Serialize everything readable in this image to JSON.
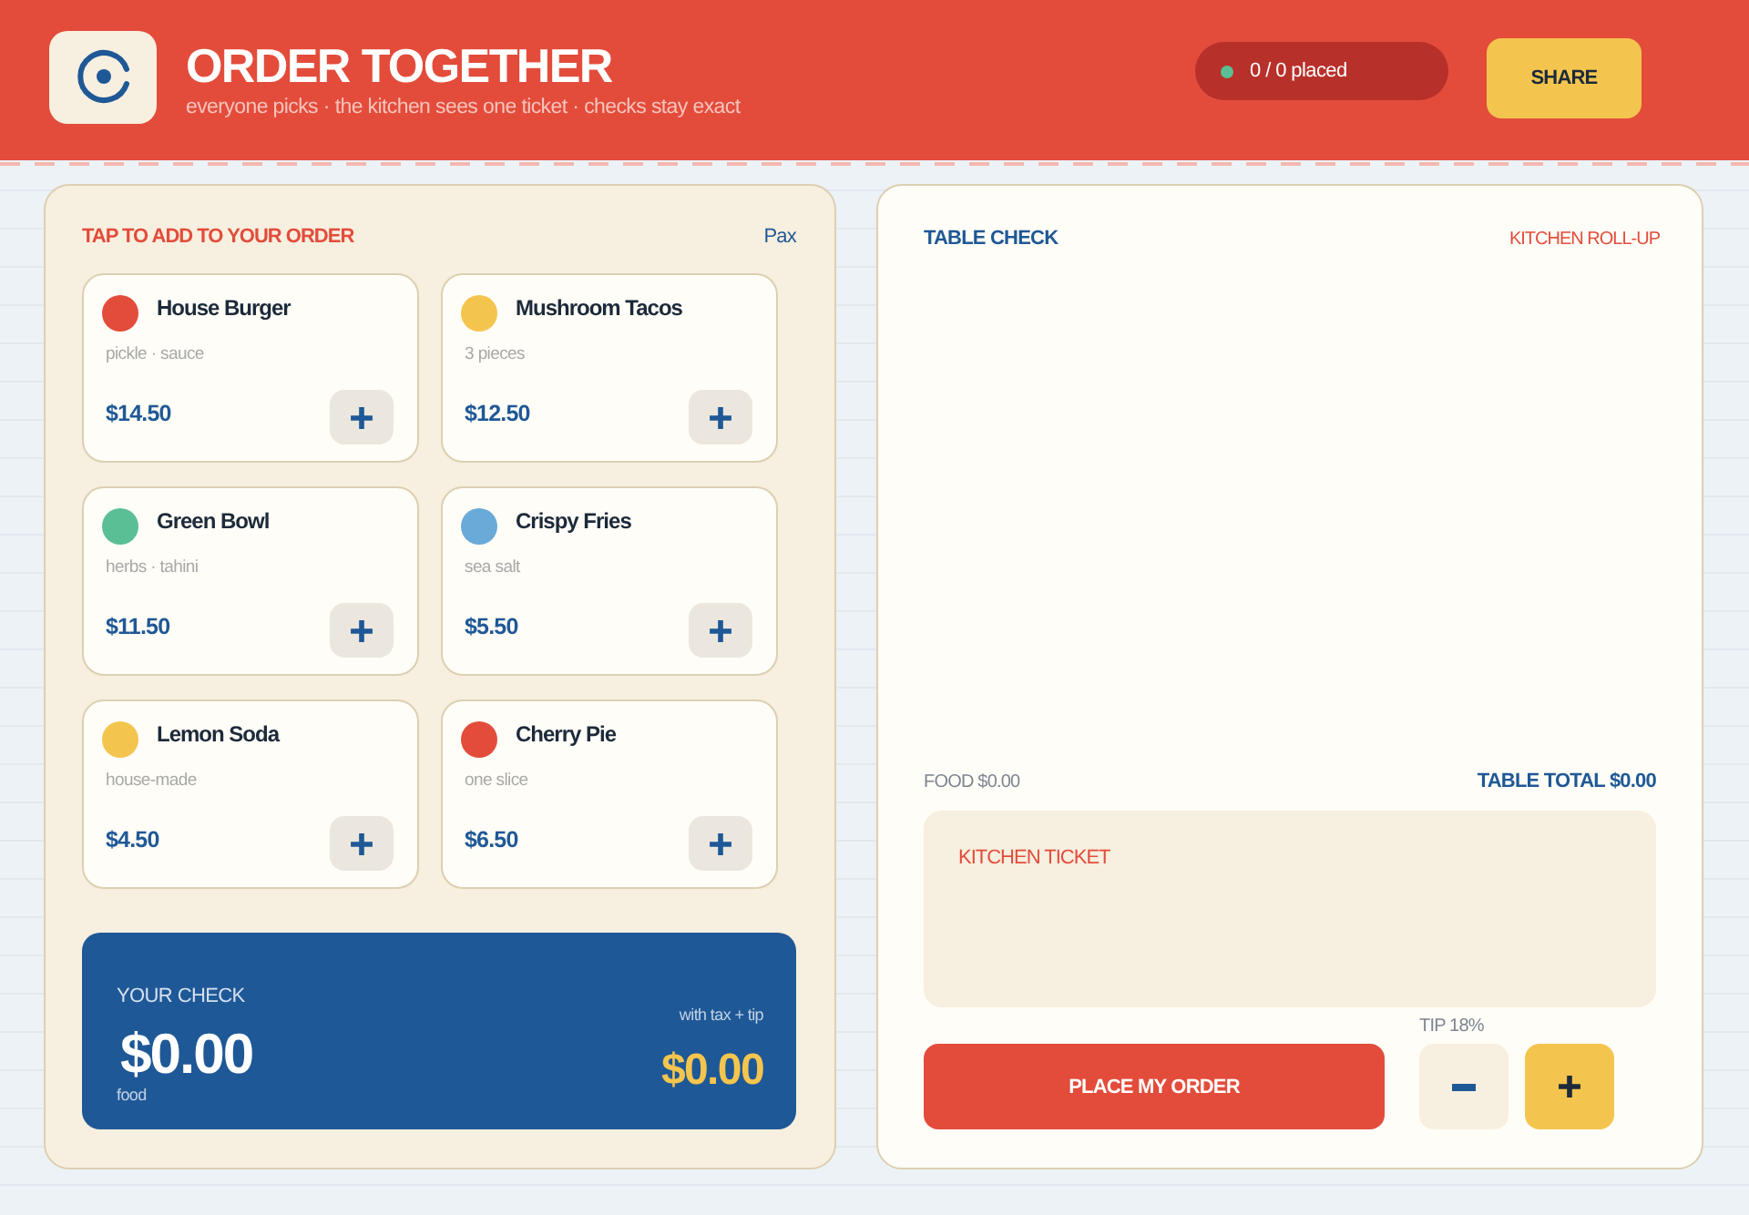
{
  "header": {
    "title": "ORDER TOGETHER",
    "subtitle": "everyone picks · the kitchen sees one ticket · checks stay exact",
    "status": "0 / 0 placed",
    "share_button": "SHARE"
  },
  "menu": {
    "heading": "TAP TO ADD TO YOUR ORDER",
    "diner": "Pax",
    "items": [
      {
        "name": "House Burger",
        "note": "pickle · sauce",
        "price": "$14.50",
        "color": "#e34c3b"
      },
      {
        "name": "Mushroom Tacos",
        "note": "3 pieces",
        "price": "$12.50",
        "color": "#f4c54e"
      },
      {
        "name": "Green Bowl",
        "note": "herbs · tahini",
        "price": "$11.50",
        "color": "#5bbf95"
      },
      {
        "name": "Crispy Fries",
        "note": "sea salt",
        "price": "$5.50",
        "color": "#6aaad8"
      },
      {
        "name": "Lemon Soda",
        "note": "house-made",
        "price": "$4.50",
        "color": "#f4c54e"
      },
      {
        "name": "Cherry Pie",
        "note": "one slice",
        "price": "$6.50",
        "color": "#e34c3b"
      }
    ]
  },
  "your_check": {
    "label": "YOUR CHECK",
    "food_total": "$0.00",
    "food_label": "food",
    "with_label": "with tax + tip",
    "grand_total": "$0.00"
  },
  "table_check": {
    "title": "TABLE CHECK",
    "mode": "KITCHEN ROLL-UP",
    "food": "FOOD $0.00",
    "total": "TABLE TOTAL $0.00",
    "ticket_title": "KITCHEN TICKET",
    "tip_label": "TIP 18%",
    "place_button": "PLACE MY ORDER"
  }
}
